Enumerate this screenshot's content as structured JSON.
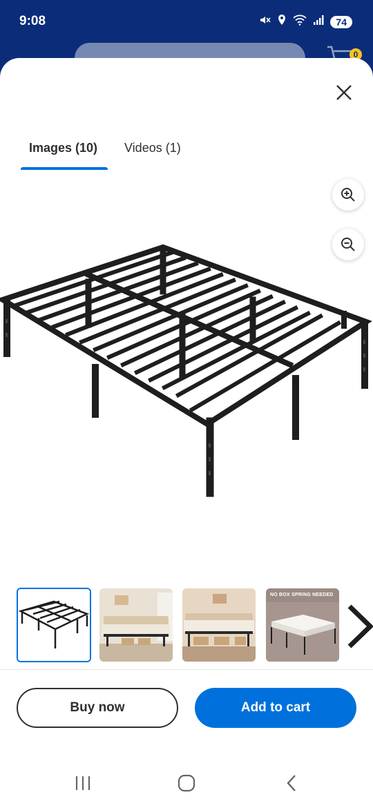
{
  "status_bar": {
    "time": "9:08",
    "battery": "74"
  },
  "header_behind": {
    "cart_count": "0"
  },
  "tabs": [
    {
      "label": "Images (10)"
    },
    {
      "label": "Videos (1)"
    }
  ],
  "thumbnails": [
    {
      "name": "thumbnail-1",
      "label": ""
    },
    {
      "name": "thumbnail-2",
      "label": ""
    },
    {
      "name": "thumbnail-3",
      "label": ""
    },
    {
      "name": "thumbnail-4",
      "label": "NO BOX SPRING NEEDED"
    }
  ],
  "actions": {
    "buy_now": "Buy now",
    "add_to_cart": "Add to cart"
  },
  "colors": {
    "brand_blue": "#0071dc",
    "header_navy": "#0b2d79",
    "badge_yellow": "#ffc220"
  },
  "icons": [
    "muted-icon",
    "location-icon",
    "wifi-icon",
    "signal-icon",
    "cart-icon",
    "close-icon",
    "zoom-in-icon",
    "zoom-out-icon",
    "chevron-right-icon",
    "recent-apps-icon",
    "home-icon",
    "back-icon"
  ]
}
